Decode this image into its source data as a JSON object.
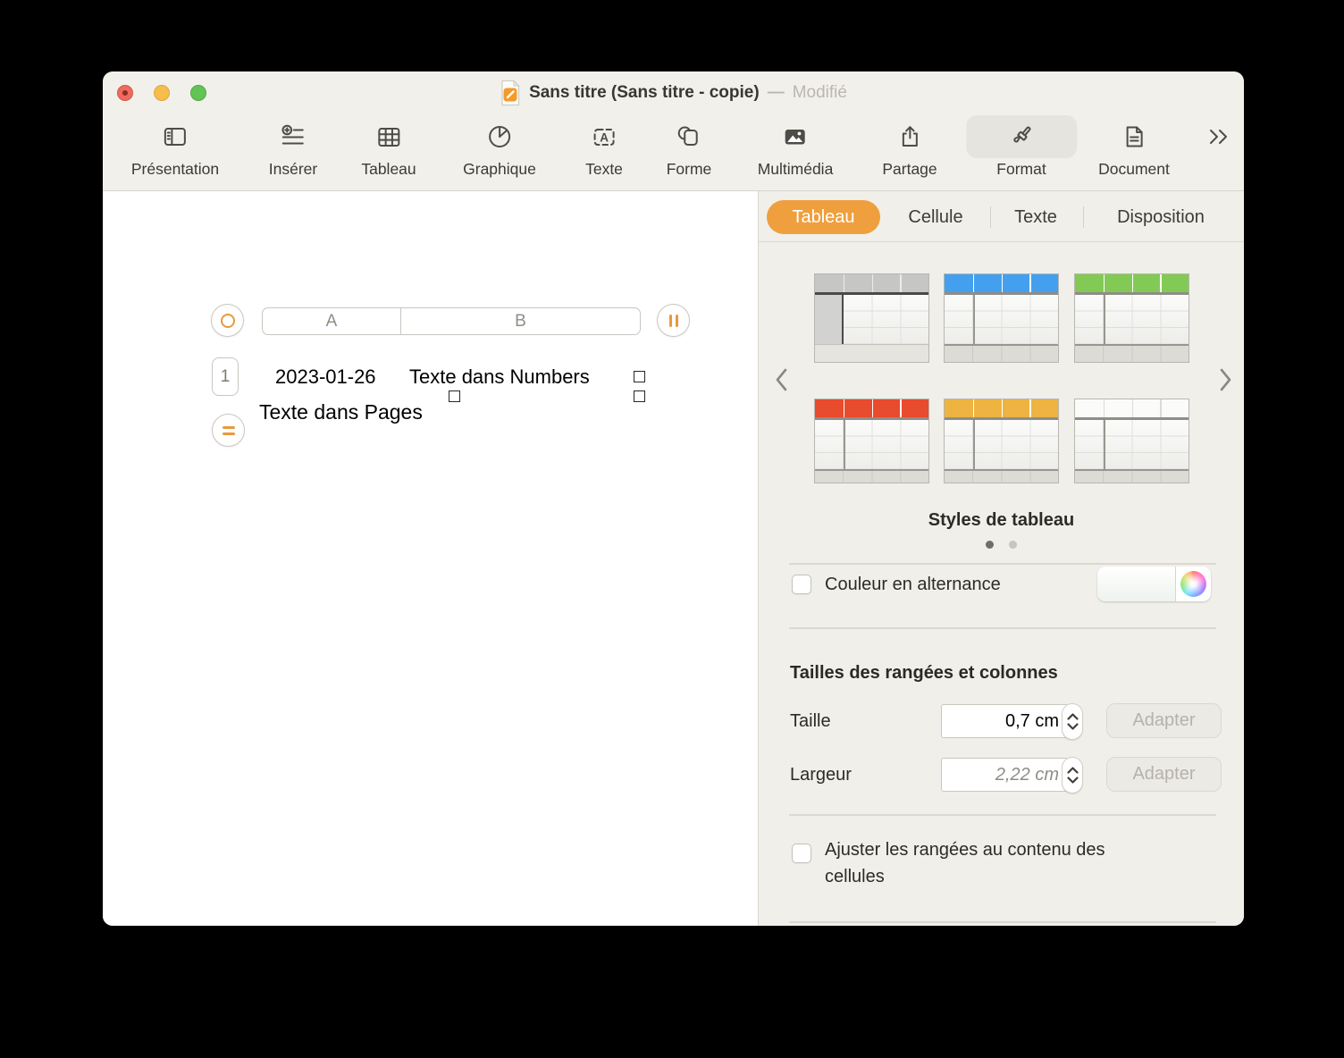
{
  "window": {
    "title": "Sans titre (Sans titre - copie)",
    "separator": "—",
    "status": "Modifié"
  },
  "toolbar": {
    "items": [
      {
        "label": "Présentation",
        "icon": "presentation-sidebar-icon"
      },
      {
        "label": "Insérer",
        "icon": "insert-plus-icon"
      },
      {
        "label": "Tableau",
        "icon": "table-grid-icon"
      },
      {
        "label": "Graphique",
        "icon": "pie-chart-icon"
      },
      {
        "label": "Texte",
        "icon": "text-box-icon"
      },
      {
        "label": "Forme",
        "icon": "shapes-icon"
      },
      {
        "label": "Multimédia",
        "icon": "photo-icon"
      },
      {
        "label": "Partage",
        "icon": "share-icon"
      },
      {
        "label": "Format",
        "icon": "paintbrush-icon",
        "active": true
      },
      {
        "label": "Document",
        "icon": "document-icon"
      }
    ],
    "overflow_icon": "chevrons-right-icon"
  },
  "canvas": {
    "table": {
      "columns": [
        "A",
        "B"
      ],
      "row_number": "1",
      "cells": [
        "2023-01-26",
        "Texte dans Numbers"
      ]
    },
    "text_box_text": "Texte dans Pages"
  },
  "inspector": {
    "accent_color": "#ef9f3d",
    "tabs": [
      {
        "label": "Tableau",
        "active": true
      },
      {
        "label": "Cellule",
        "active": false
      },
      {
        "label": "Texte",
        "active": false
      },
      {
        "label": "Disposition",
        "active": false
      }
    ],
    "table_styles": [
      {
        "name": "simple-gris",
        "header_color": "#c6c6c5",
        "accent_line": "#4a4a48",
        "separator_color": "#ebebe9",
        "gray_first_column": true
      },
      {
        "name": "entete-bleue",
        "header_color": "#44a0ee",
        "accent_line": "#8f8d88",
        "separator_color": "#ffffff",
        "gray_first_column": false
      },
      {
        "name": "entete-verte",
        "header_color": "#82ca55",
        "accent_line": "#8f8d88",
        "separator_color": "#ffffff",
        "gray_first_column": false
      },
      {
        "name": "entete-rouge",
        "header_color": "#e84b2d",
        "accent_line": "#8f8d88",
        "separator_color": "#ffffff",
        "gray_first_column": false
      },
      {
        "name": "entete-jaune",
        "header_color": "#edb441",
        "accent_line": "#8f8d88",
        "separator_color": "#ffffff",
        "gray_first_column": false
      },
      {
        "name": "blanc",
        "header_color": "#fbfbfa",
        "accent_line": "#8f8d88",
        "separator_color": "#dadad7",
        "gray_first_column": false
      }
    ],
    "styles_title": "Styles de tableau",
    "pagination": {
      "total": 2,
      "active": 0
    },
    "alternating": {
      "label": "Couleur en alternance",
      "checked": false
    },
    "sizes": {
      "heading": "Tailles des rangées et colonnes",
      "rows": [
        {
          "label": "Taille",
          "value": "0,7 cm",
          "muted": false,
          "button": "Adapter"
        },
        {
          "label": "Largeur",
          "value": "2,22 cm",
          "muted": true,
          "button": "Adapter"
        }
      ]
    },
    "fit": {
      "label": "Ajuster les rangées au contenu des cellules",
      "checked": false
    }
  }
}
